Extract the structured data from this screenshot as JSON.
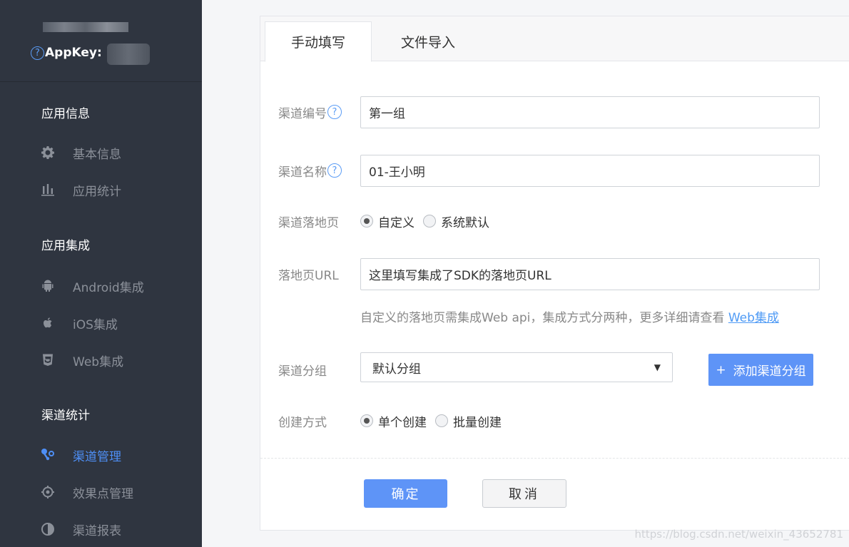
{
  "sidebar": {
    "appkey_label": "AppKey:",
    "sections": {
      "app_info": "应用信息",
      "app_integration": "应用集成",
      "channel_stats": "渠道统计"
    },
    "items": {
      "basic_info": "基本信息",
      "app_stats": "应用统计",
      "android": "Android集成",
      "ios": "iOS集成",
      "web": "Web集成",
      "channel_mgmt": "渠道管理",
      "effect_mgmt": "效果点管理",
      "channel_report": "渠道报表"
    },
    "active_item": "渠道管理",
    "icons": [
      "gear-icon",
      "bar-chart-icon",
      "android-icon",
      "apple-icon",
      "html5-icon",
      "channel-icon",
      "target-icon",
      "half-circle-icon"
    ]
  },
  "tabs": {
    "manual": "手动填写",
    "import": "文件导入"
  },
  "form": {
    "channel_code_label": "渠道编号",
    "channel_code_value": "第一组",
    "channel_name_label": "渠道名称",
    "channel_name_value": "01-王小明",
    "landing_label": "渠道落地页",
    "landing_custom": "自定义",
    "landing_default": "系统默认",
    "landing_url_label": "落地页URL",
    "landing_url_value": "这里填写集成了SDK的落地页URL",
    "hint_text": "自定义的落地页需集成Web api，集成方式分两种，更多详细请查看 ",
    "hint_link": "Web集成",
    "group_label": "渠道分组",
    "group_value": "默认分组",
    "add_group": "添加渠道分组",
    "create_label": "创建方式",
    "create_single": "单个创建",
    "create_batch": "批量创建",
    "confirm": "确定",
    "cancel": "取消"
  },
  "watermark": "https://blog.csdn.net/weixin_43652781",
  "colors": {
    "sidebar_bg": "#2f3540",
    "accent": "#5e94f7",
    "link": "#4e9af5"
  }
}
